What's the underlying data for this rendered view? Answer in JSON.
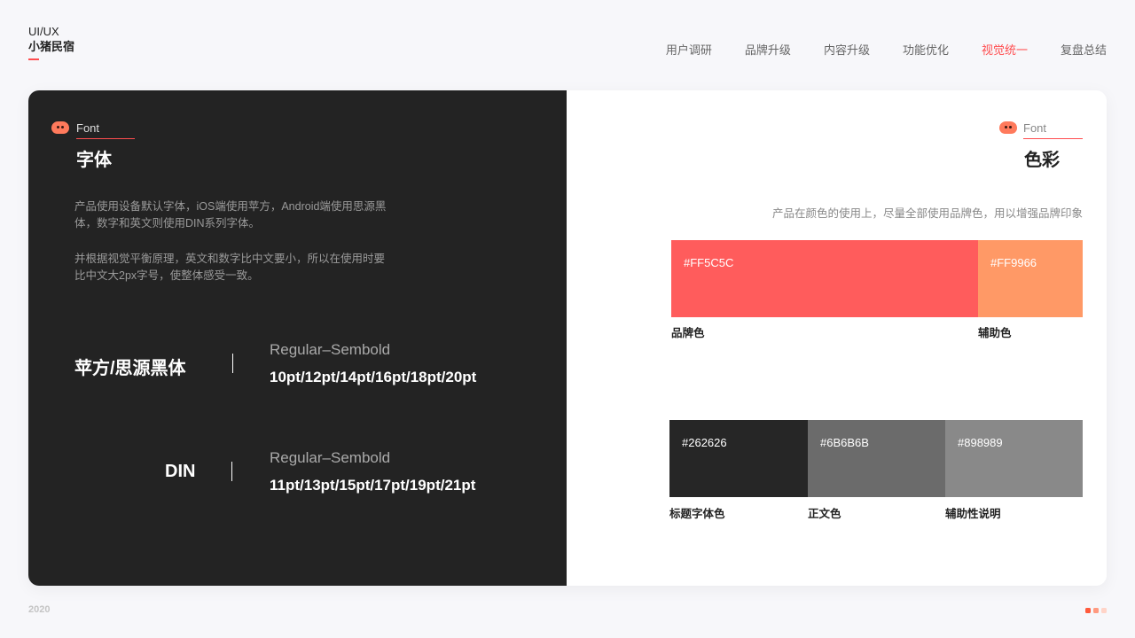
{
  "brand": {
    "line1": "UI/UX",
    "line2": "小猪民宿"
  },
  "nav": {
    "items": [
      "用户调研",
      "品牌升级",
      "内容升级",
      "功能优化",
      "视觉统一",
      "复盘总结"
    ],
    "active_index": 4
  },
  "font_section": {
    "label_en": "Font",
    "title": "字体",
    "icon": "pig-icon",
    "paragraphs": [
      "产品使用设备默认字体，iOS端使用苹方，Android端使用思源黑体，数字和英文则使用DIN系列字体。",
      "并根据视觉平衡原理，英文和数字比中文要小，所以在使用时要比中文大2px字号，使整体感受一致。"
    ],
    "specs": [
      {
        "name": "苹方/思源黑体",
        "weight": "Regular–Sembold",
        "sizes": "10pt/12pt/14pt/16pt/18pt/20pt"
      },
      {
        "name": "DIN",
        "weight": "Regular–Sembold",
        "sizes": "11pt/13pt/15pt/17pt/19pt/21pt"
      }
    ]
  },
  "color_section": {
    "label_en": "Font",
    "title": "色彩",
    "icon": "pig-icon",
    "description": "产品在颜色的使用上，尽量全部使用品牌色，用以增强品牌印象",
    "primary_row": [
      {
        "code": "#FF5C5C",
        "label": "品牌色"
      },
      {
        "code": "#FF9966",
        "label": "辅助色"
      }
    ],
    "text_row": [
      {
        "code": "#262626",
        "label": "标题字体色"
      },
      {
        "code": "#6B6B6B",
        "label": "正文色"
      },
      {
        "code": "#898989",
        "label": "辅助性说明"
      }
    ]
  },
  "footer": {
    "year": "2020",
    "page_dots": [
      "#ff5a3c",
      "#ff9a80",
      "#ffd4c8"
    ]
  },
  "colors": {
    "accent": "#ff4d4f",
    "dark_panel": "#232323"
  }
}
